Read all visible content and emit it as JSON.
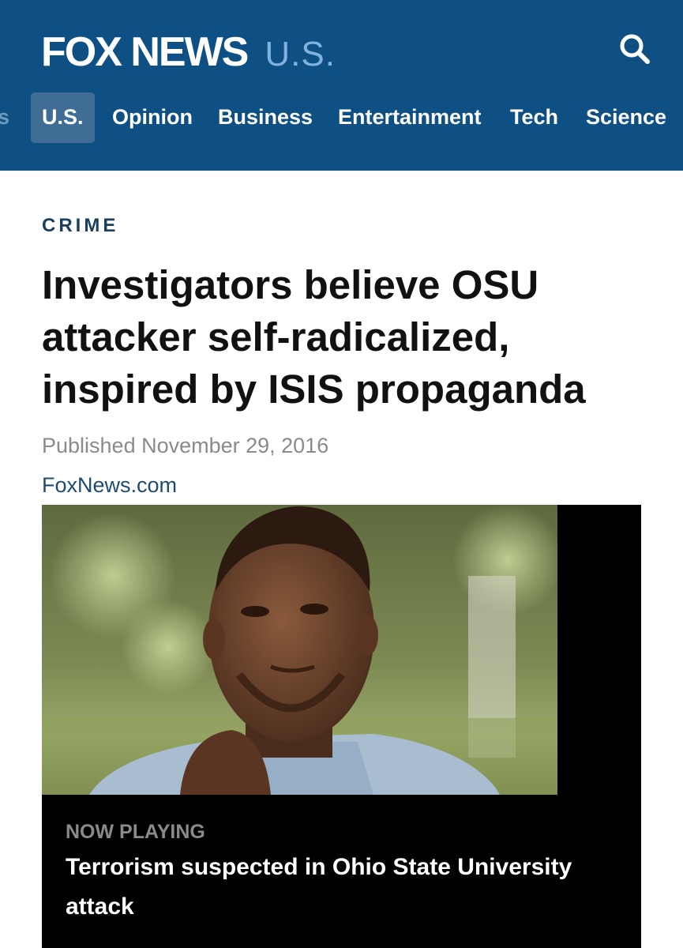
{
  "header": {
    "logo": "FOX NEWS",
    "section": "U.S."
  },
  "nav": {
    "items": [
      {
        "label": "s"
      },
      {
        "label": "U.S."
      },
      {
        "label": "Opinion"
      },
      {
        "label": "Business"
      },
      {
        "label": "Entertainment"
      },
      {
        "label": "Tech"
      },
      {
        "label": "Science"
      }
    ],
    "active": "U.S."
  },
  "article": {
    "category": "CRIME",
    "headline": "Investigators believe OSU attacker self-radicalized, inspired by ISIS propaganda",
    "published": "Published November 29, 2016",
    "source": "FoxNews.com"
  },
  "video": {
    "status": "NOW PLAYING",
    "title": "Terrorism suspected in Ohio State University attack"
  },
  "colors": {
    "header_bg": "#0f5084",
    "nav_active_bg": "#3f6d96",
    "logo_section": "#7fb2dd",
    "category": "#1a3e5e",
    "source_link": "#1f4b73"
  }
}
